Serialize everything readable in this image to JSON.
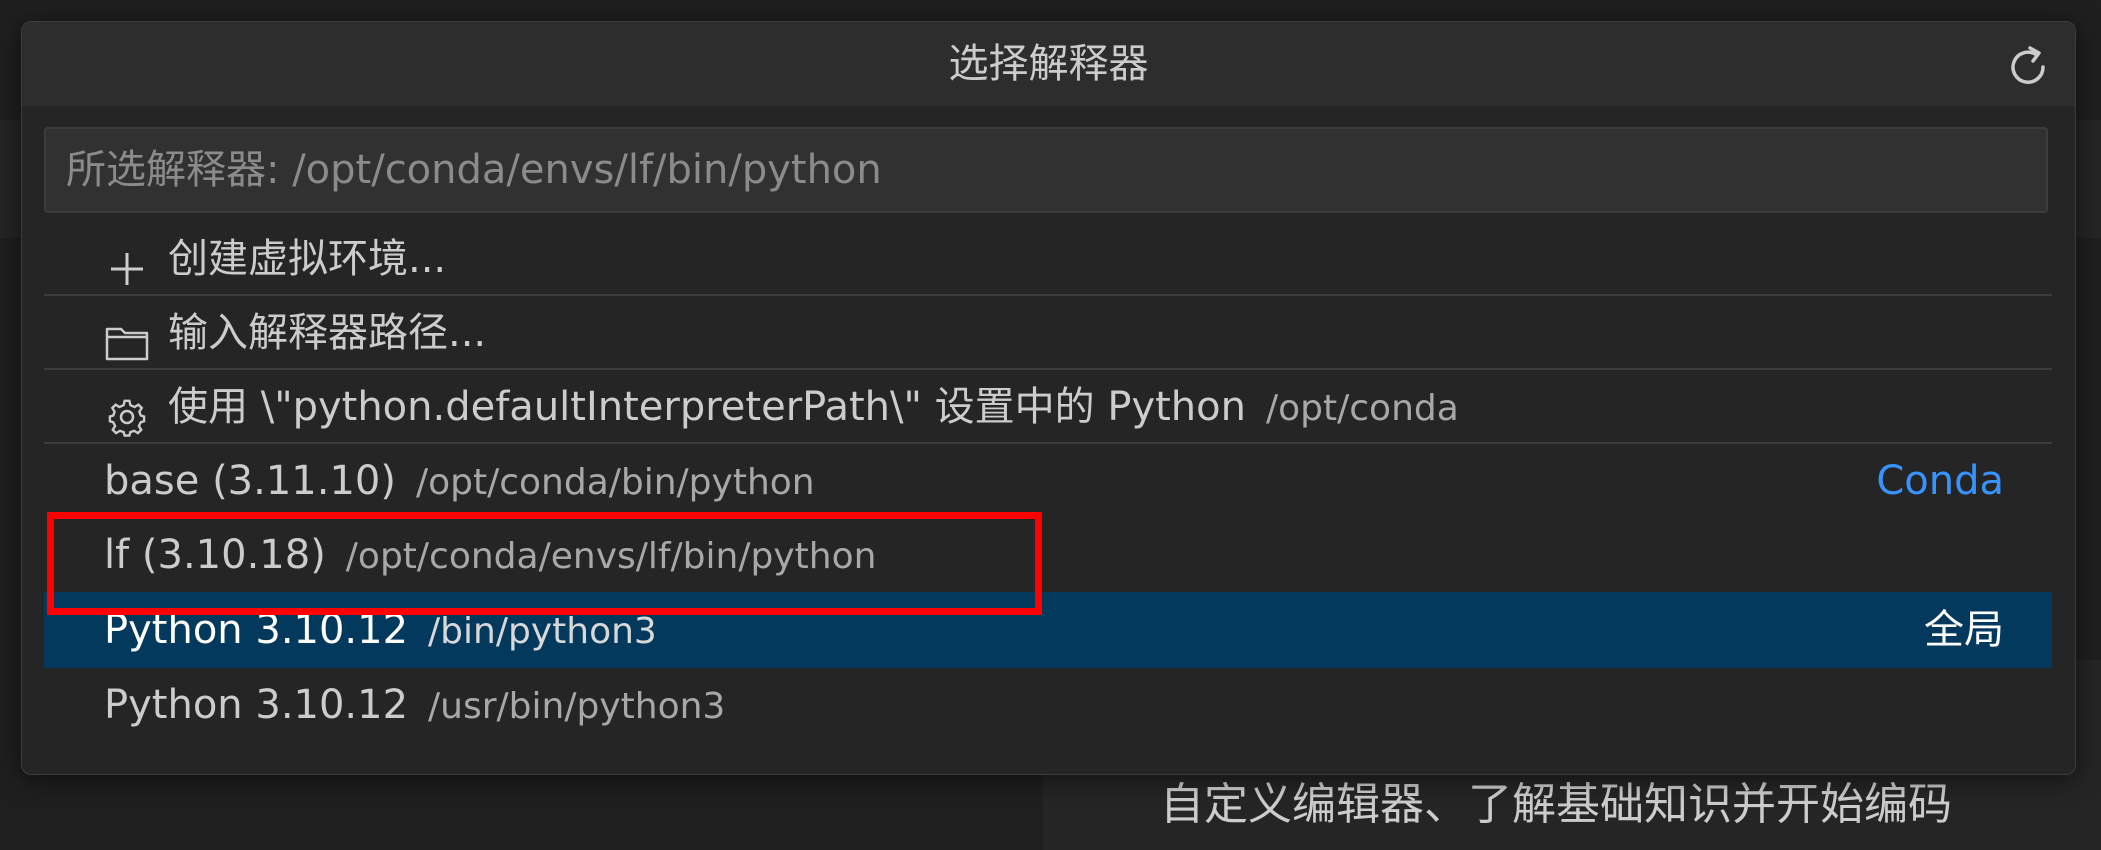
{
  "background": {
    "panel_text": "自定义编辑器、了解基础知识并开始编码"
  },
  "quick_pick": {
    "title": "选择解释器",
    "refresh_icon": "refresh-icon",
    "input": {
      "placeholder": "所选解释器: /opt/conda/envs/lf/bin/python",
      "value": ""
    },
    "items": [
      {
        "icon": "plus-icon",
        "label": "创建虚拟环境...",
        "description": "",
        "tag": ""
      },
      {
        "icon": "folder-icon",
        "label": "输入解释器路径...",
        "description": "",
        "tag": ""
      },
      {
        "icon": "gear-icon",
        "label": "使用 \\\"python.defaultInterpreterPath\\\" 设置中的 Python",
        "description": "/opt/conda",
        "tag": ""
      },
      {
        "icon": "",
        "label": "base (3.11.10)",
        "description": "/opt/conda/bin/python",
        "tag": "Conda"
      },
      {
        "icon": "",
        "label": "lf (3.10.18)",
        "description": "/opt/conda/envs/lf/bin/python",
        "tag": ""
      },
      {
        "icon": "",
        "label": "Python 3.10.12",
        "description": "/bin/python3",
        "tag": "全局"
      },
      {
        "icon": "",
        "label": "Python 3.10.12",
        "description": "/usr/bin/python3",
        "tag": ""
      }
    ],
    "selected_index": 5
  },
  "colors": {
    "accent_blue": "#3794ff",
    "selection_bg": "#04395e",
    "highlight_red": "#ff0000"
  }
}
